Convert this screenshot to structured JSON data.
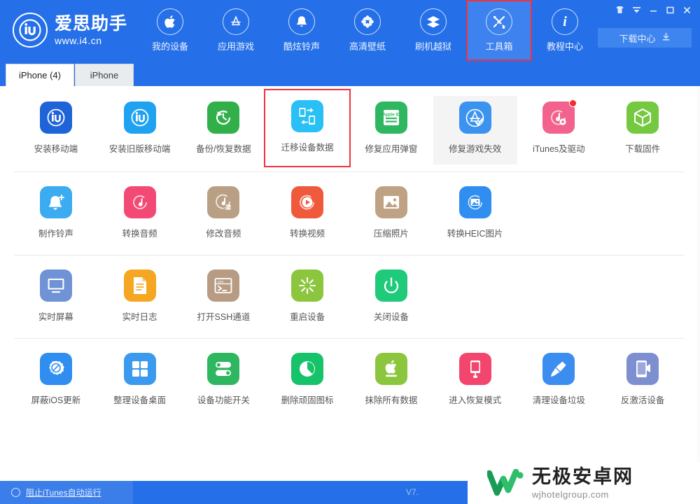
{
  "window": {
    "controls": [
      {
        "name": "skin-icon",
        "glyph": "\u0000"
      },
      {
        "name": "menu-icon",
        "glyph": "\u0000"
      },
      {
        "name": "minimize-icon",
        "glyph": "\u0000"
      },
      {
        "name": "maximize-icon",
        "glyph": "\u0000"
      },
      {
        "name": "close-icon",
        "glyph": "\u0000"
      }
    ]
  },
  "brand": {
    "logo_text": "iU",
    "name": "爱思助手",
    "url": "www.i4.cn"
  },
  "nav": {
    "items": [
      {
        "label": "我的设备",
        "icon": "apple-icon",
        "active": false,
        "highlight": false
      },
      {
        "label": "应用游戏",
        "icon": "appstore-icon",
        "active": false,
        "highlight": false
      },
      {
        "label": "酷炫铃声",
        "icon": "bell-icon",
        "active": false,
        "highlight": false
      },
      {
        "label": "高清壁纸",
        "icon": "flower-icon",
        "active": false,
        "highlight": false
      },
      {
        "label": "刷机越狱",
        "icon": "box-open-icon",
        "active": false,
        "highlight": false
      },
      {
        "label": "工具箱",
        "icon": "tools-icon",
        "active": true,
        "highlight": true
      },
      {
        "label": "教程中心",
        "icon": "info-icon",
        "active": false,
        "highlight": false
      }
    ]
  },
  "download_center": {
    "label": "下载中心",
    "icon": "download-icon"
  },
  "tabs": [
    {
      "label": "iPhone (4)",
      "active": true
    },
    {
      "label": "iPhone",
      "active": false
    }
  ],
  "toolbox": {
    "rows": [
      [
        {
          "label": "安装移动端",
          "icon": "i4-app-icon",
          "color": "#1f63d8",
          "state": "normal"
        },
        {
          "label": "安装旧版移动端",
          "icon": "i4-app-old-icon",
          "color": "#1fa2f0",
          "state": "normal"
        },
        {
          "label": "备份/恢复数据",
          "icon": "backup-restore-icon",
          "color": "#31b04a",
          "state": "normal"
        },
        {
          "label": "迁移设备数据",
          "icon": "migrate-data-icon",
          "color": "#29c0f5",
          "state": "selected"
        },
        {
          "label": "修复应用弹窗",
          "icon": "appleid-fix-icon",
          "color": "#2eb760",
          "state": "normal"
        },
        {
          "label": "修复游戏失效",
          "icon": "appstore-fix-icon",
          "color": "#3b93ef",
          "state": "hover"
        },
        {
          "label": "iTunes及驱动",
          "icon": "itunes-driver-icon",
          "color": "#f2628c",
          "state": "normal",
          "badge": true
        },
        {
          "label": "下载固件",
          "icon": "firmware-icon",
          "color": "#74c940",
          "state": "normal"
        }
      ],
      [
        {
          "label": "制作铃声",
          "icon": "make-ringtone-icon",
          "color": "#3bacf0",
          "state": "normal"
        },
        {
          "label": "转换音频",
          "icon": "convert-audio-icon",
          "color": "#f24a74",
          "state": "normal"
        },
        {
          "label": "修改音频",
          "icon": "edit-audio-icon",
          "color": "#b9a085",
          "state": "normal"
        },
        {
          "label": "转换视频",
          "icon": "convert-video-icon",
          "color": "#f05a3c",
          "state": "normal"
        },
        {
          "label": "压缩照片",
          "icon": "compress-photo-icon",
          "color": "#bfa283",
          "state": "normal"
        },
        {
          "label": "转换HEIC图片",
          "icon": "convert-heic-icon",
          "color": "#2f8ef0",
          "state": "normal"
        }
      ],
      [
        {
          "label": "实时屏幕",
          "icon": "live-screen-icon",
          "color": "#6f93d6",
          "state": "normal"
        },
        {
          "label": "实时日志",
          "icon": "live-log-icon",
          "color": "#f5a623",
          "state": "normal"
        },
        {
          "label": "打开SSH通道",
          "icon": "ssh-terminal-icon",
          "color": "#b79c83",
          "state": "normal"
        },
        {
          "label": "重启设备",
          "icon": "restart-device-icon",
          "color": "#8cc63e",
          "state": "normal"
        },
        {
          "label": "关闭设备",
          "icon": "shutdown-device-icon",
          "color": "#1fca7a",
          "state": "normal"
        }
      ],
      [
        {
          "label": "屏蔽iOS更新",
          "icon": "block-ios-update-icon",
          "color": "#2f8ef0",
          "state": "normal"
        },
        {
          "label": "整理设备桌面",
          "icon": "organize-desktop-icon",
          "color": "#3b9aee",
          "state": "normal"
        },
        {
          "label": "设备功能开关",
          "icon": "device-toggle-icon",
          "color": "#2eb760",
          "state": "normal"
        },
        {
          "label": "删除顽固图标",
          "icon": "delete-stuck-icon",
          "color": "#16c26a",
          "state": "normal"
        },
        {
          "label": "抹除所有数据",
          "icon": "erase-all-icon",
          "color": "#8cc63e",
          "state": "normal"
        },
        {
          "label": "进入恢复模式",
          "icon": "recovery-mode-icon",
          "color": "#f2466f",
          "state": "normal"
        },
        {
          "label": "清理设备垃圾",
          "icon": "clean-junk-icon",
          "color": "#3b8ef0",
          "state": "normal"
        },
        {
          "label": "反激活设备",
          "icon": "deactivate-device-icon",
          "color": "#7d8fd1",
          "state": "normal"
        }
      ]
    ]
  },
  "footer": {
    "checkbox_label": "阻止iTunes自动运行",
    "checkbox_checked": false,
    "version": "V7."
  },
  "watermark": {
    "title": "无极安卓网",
    "subtitle": "wjhotelgroup.com",
    "logo": "w-logo-icon"
  },
  "colors": {
    "header_blue": "#2570e8",
    "accent_red": "#f0323c",
    "nav_active": "#3d82ef"
  }
}
